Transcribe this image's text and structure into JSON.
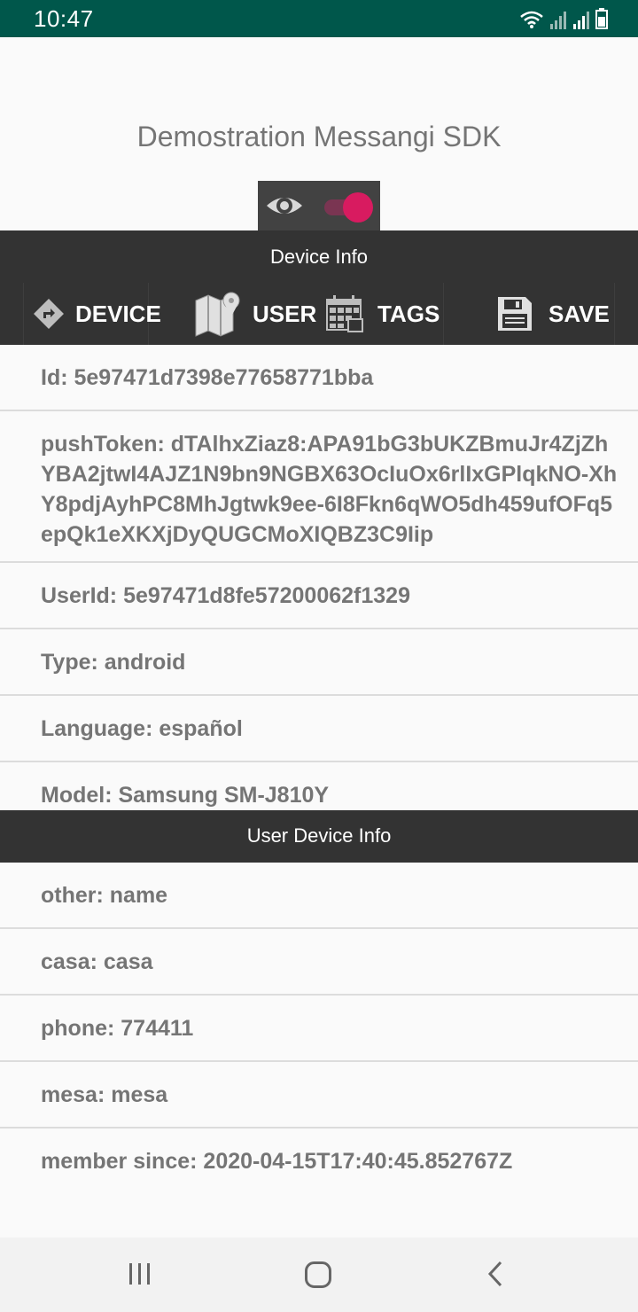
{
  "status_bar": {
    "time": "10:47"
  },
  "app": {
    "title": "Demostration Messangi SDK"
  },
  "device_info": {
    "section_title": "Device Info",
    "tabs": [
      {
        "label": "DEVICE",
        "icon": "directions-icon"
      },
      {
        "label": "USER",
        "icon": "map-icon"
      },
      {
        "label": "TAGS",
        "icon": "calendar-grid-icon"
      },
      {
        "label": "SAVE",
        "icon": "save-icon"
      }
    ],
    "fields": [
      "Id: 5e97471d7398e77658771bba",
      "pushToken: dTAlhxZiaz8:APA91bG3bUKZBmuJr4ZjZhYBA2jtwI4AJZ1N9bn9NGBX63OcIuOx6rlIxGPlqkNO-XhY8pdjAyhPC8MhJgtwk9ee-6I8Fkn6qWO5dh459ufOFq5epQk1eXKXjDyQUGCMoXIQBZ3C9Iip",
      "UserId: 5e97471d8fe57200062f1329",
      "Type: android",
      "Language: español",
      "Model: Samsung SM-J810Y"
    ]
  },
  "user_device_info": {
    "section_title": "User Device Info",
    "fields": [
      "other: name",
      "casa: casa",
      "phone: 774411",
      "mesa: mesa",
      "member since: 2020-04-15T17:40:45.852767Z"
    ]
  },
  "colors": {
    "status_bar": "#00574b",
    "panel": "#333333",
    "accent": "#d81b60",
    "text": "#757575"
  }
}
